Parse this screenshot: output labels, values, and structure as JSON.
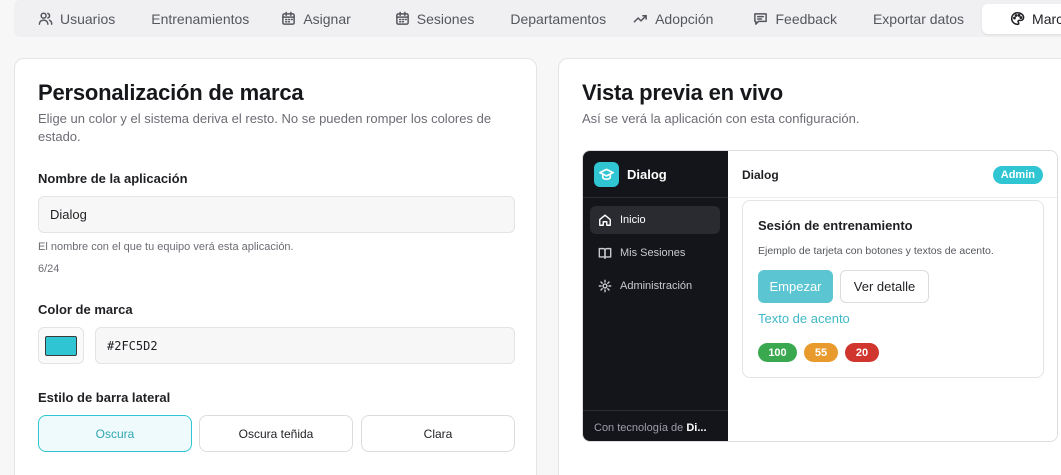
{
  "tabs": [
    {
      "label": "Usuarios",
      "icon": "users-icon"
    },
    {
      "label": "Entrenamientos",
      "icon": ""
    },
    {
      "label": "Asignar",
      "icon": "calendar-icon"
    },
    {
      "label": "Sesiones",
      "icon": "calendar-icon"
    },
    {
      "label": "Departamentos",
      "icon": ""
    },
    {
      "label": "Adopción",
      "icon": "trending-up-icon"
    },
    {
      "label": "Feedback",
      "icon": "message-icon"
    },
    {
      "label": "Exportar datos",
      "icon": ""
    },
    {
      "label": "Marca",
      "icon": "palette-icon",
      "active": true
    }
  ],
  "branding": {
    "title": "Personalización de marca",
    "subtitle": "Elige un color y el sistema deriva el resto. No se pueden romper los colores de estado.",
    "app_name_label": "Nombre de la aplicación",
    "app_name_value": "Dialog",
    "app_name_hint": "El nombre con el que tu equipo verá esta aplicación.",
    "app_name_count": "6/24",
    "brand_color_label": "Color de marca",
    "brand_color_value": "#2FC5D2",
    "sidebar_style_label": "Estilo de barra lateral",
    "sidebar_styles": [
      "Oscura",
      "Oscura teñida",
      "Clara"
    ],
    "sidebar_style_selected": "Oscura"
  },
  "preview": {
    "title": "Vista previa en vivo",
    "subtitle": "Así se verá la aplicación con esta configuración.",
    "brand_name": "Dialog",
    "nav": [
      {
        "label": "Inicio",
        "icon": "home-icon",
        "active": true
      },
      {
        "label": "Mis Sesiones",
        "icon": "book-icon"
      },
      {
        "label": "Administración",
        "icon": "gear-icon"
      }
    ],
    "footer_prefix": "Con tecnología de",
    "footer_brand": "Di...",
    "header_title": "Dialog",
    "admin_badge": "Admin",
    "card_title": "Sesión de entrenamiento",
    "card_desc": "Ejemplo de tarjeta con botones y textos de acento.",
    "primary_button": "Empezar",
    "secondary_button": "Ver detalle",
    "accent_text": "Texto de acento",
    "pills": [
      {
        "label": "100",
        "color": "#3aa84f"
      },
      {
        "label": "55",
        "color": "#e89a2c"
      },
      {
        "label": "20",
        "color": "#d0352e"
      }
    ]
  },
  "colors": {
    "brand": "#2FC5D2",
    "sidebar_dark": "#14151a"
  }
}
